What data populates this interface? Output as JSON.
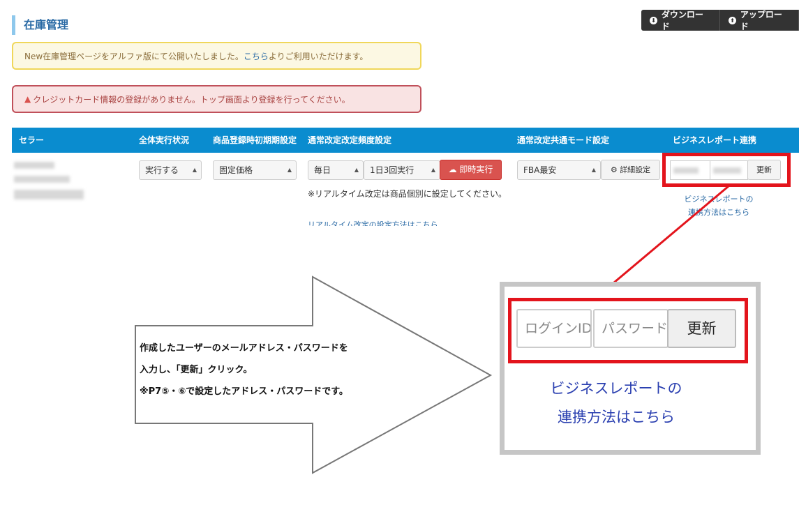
{
  "page": {
    "title": "在庫管理"
  },
  "top_buttons": [
    {
      "label": "ダウンロード",
      "icon": "download-icon"
    },
    {
      "label": "アップロード",
      "icon": "upload-icon"
    }
  ],
  "alerts": {
    "info_text": "New在庫管理ページをアルファ版にて公開いたしました。",
    "info_link": "こちら",
    "info_suffix": "よりご利用いただけます。",
    "warning_text": "クレジットカード情報の登録がありません。トップ画面より登録を行ってください。"
  },
  "table": {
    "headers": [
      "セラー",
      "全体実行状況",
      "商品登録時初期期設定",
      "通常改定改定頻度設定",
      "通常改定共通モード設定",
      "ビジネスレポート連携"
    ],
    "row": {
      "status_select": "実行する",
      "initial_select": "固定価格",
      "frequency_select": "毎日",
      "times_select": "1日3回実行",
      "run_now_label": "即時実行",
      "note": "※リアルタイム改定は商品個別に設定してください。",
      "note_link": "リアルタイム改定の設定方法はこちら",
      "mode_select": "FBA最安",
      "detail_label": "詳細設定",
      "update_label": "更新",
      "biz_link_line1": "ビジネスレポートの",
      "biz_link_line2": "連携方法はこちら"
    }
  },
  "zoom": {
    "login_placeholder": "ログインID",
    "password_placeholder": "パスワード",
    "update_label": "更新",
    "link_line1": "ビジネスレポートの",
    "link_line2": "連携方法はこちら"
  },
  "callout": {
    "line1": "作成したユーザーのメールアドレス・パスワードを",
    "line2": "入力し、「更新」クリック。",
    "line3": "※P7⑤・⑥で設定したアドレス・パスワードです。"
  },
  "colors": {
    "header_bg": "#0a8ccf",
    "highlight": "#e3141c",
    "danger": "#d9534f"
  }
}
